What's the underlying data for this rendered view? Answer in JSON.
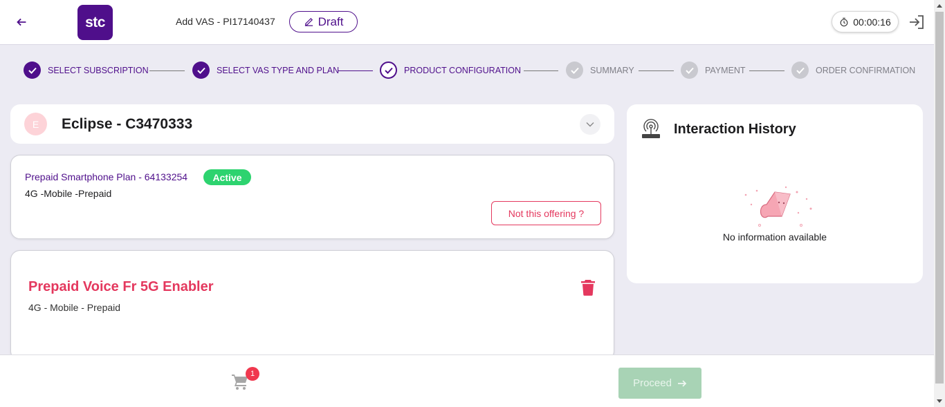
{
  "header": {
    "logo_text": "stc",
    "title": "Add VAS - PI17140437",
    "draft_label": "Draft",
    "timer": "00:00:16"
  },
  "stepper": {
    "steps": [
      {
        "label": "SELECT SUBSCRIPTION",
        "state": "done"
      },
      {
        "label": "SELECT VAS TYPE AND PLAN",
        "state": "done"
      },
      {
        "label": "PRODUCT CONFIGURATION",
        "state": "current"
      },
      {
        "label": "SUMMARY",
        "state": "todo"
      },
      {
        "label": "PAYMENT",
        "state": "todo"
      },
      {
        "label": "ORDER CONFIRMATION",
        "state": "todo"
      }
    ]
  },
  "customer": {
    "avatar_letter": "E",
    "name": "Eclipse - C3470333"
  },
  "plan": {
    "name": "Prepaid Smartphone Plan - 64133254",
    "status": "Active",
    "description": "4G -Mobile -Prepaid",
    "not_offering_label": "Not this offering ?"
  },
  "vas": {
    "name": "Prepaid Voice Fr 5G Enabler",
    "description": "4G - Mobile - Prepaid"
  },
  "history": {
    "title": "Interaction History",
    "empty_text": "No information available"
  },
  "footer": {
    "cart_count": "1",
    "proceed_label": "Proceed"
  },
  "colors": {
    "brand": "#4f0f8b",
    "accent_red": "#e4385e",
    "active_green": "#2dd36f",
    "proceed_disabled": "#a8d3b5"
  },
  "icons": [
    "back-arrow-icon",
    "edit-pencil-icon",
    "timer-icon",
    "logout-icon",
    "check-icon",
    "chevron-down-icon",
    "trash-icon",
    "interaction-history-icon",
    "empty-state-illustration",
    "cart-icon",
    "arrow-right-icon"
  ]
}
